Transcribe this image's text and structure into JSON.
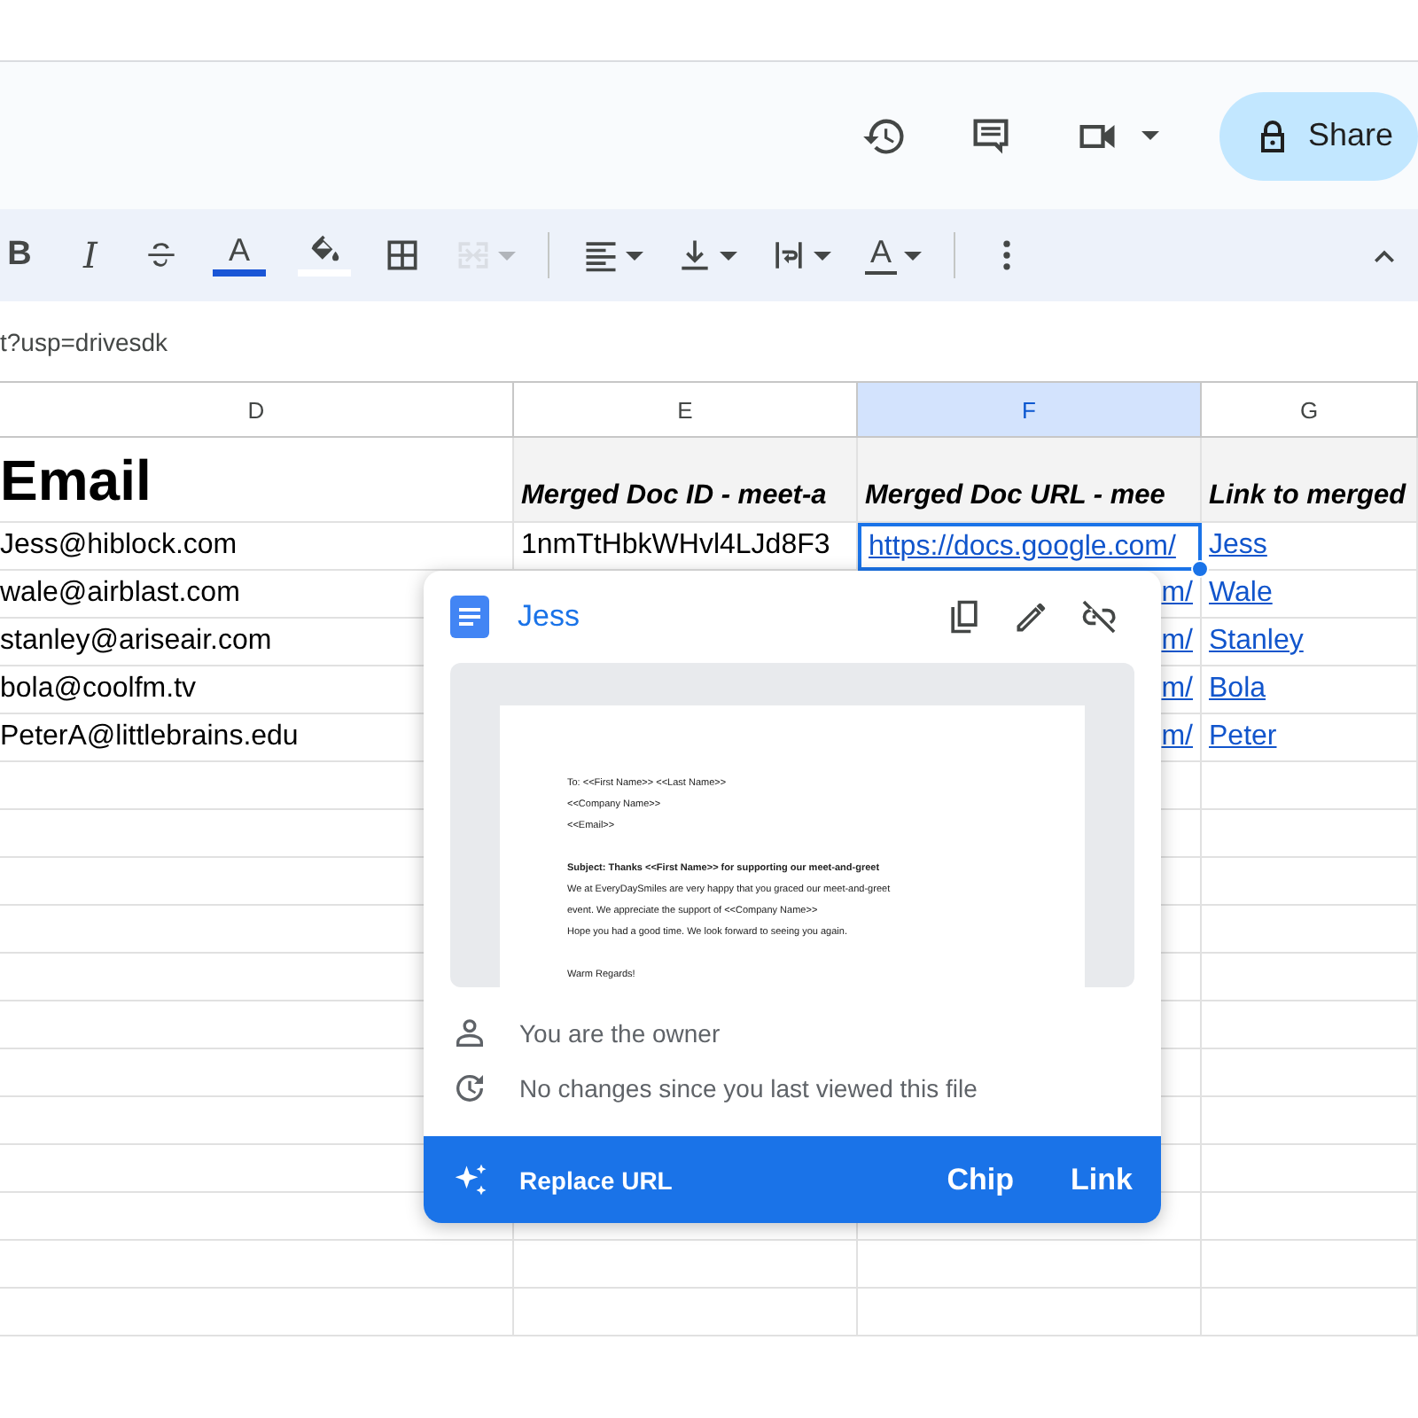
{
  "header_actions": [
    {
      "kind": "history"
    },
    {
      "kind": "comments"
    },
    {
      "kind": "meet"
    }
  ],
  "share_button": {
    "label": "Share"
  },
  "toolbar": [
    {
      "kind": "bold",
      "label": "B",
      "disabled": false
    },
    {
      "kind": "italic",
      "label": "I",
      "disabled": false
    },
    {
      "kind": "strikethrough",
      "disabled": false
    },
    {
      "kind": "text_color",
      "label": "A",
      "color": "#1a56d6",
      "disabled": false
    },
    {
      "kind": "fill_color",
      "color": "#ffffff",
      "disabled": false
    },
    {
      "kind": "borders",
      "disabled": false
    },
    {
      "kind": "merge",
      "disabled": true
    },
    {
      "kind": "separator"
    },
    {
      "kind": "align",
      "disabled": false
    },
    {
      "kind": "valign",
      "disabled": false
    },
    {
      "kind": "wrap",
      "disabled": false
    },
    {
      "kind": "rotate",
      "label": "A",
      "disabled": false
    },
    {
      "kind": "separator"
    },
    {
      "kind": "more",
      "disabled": false
    },
    {
      "kind": "collapse",
      "disabled": false
    }
  ],
  "formula_bar": {
    "value": "t?usp=drivesdk"
  },
  "columns": [
    {
      "label": "D",
      "selected": false
    },
    {
      "label": "E",
      "selected": false
    },
    {
      "label": "F",
      "selected": true
    },
    {
      "label": "G",
      "selected": false
    }
  ],
  "header_row": [
    "Email",
    "Merged Doc ID - meet-a",
    "Merged Doc URL - mee",
    "Link to merged"
  ],
  "rows": [
    {
      "cells": [
        {
          "kind": "text",
          "text": "Jess@hiblock.com",
          "selected": false
        },
        {
          "kind": "text",
          "text": "1nmTtHbkWHvl4LJd8F3",
          "selected": false
        },
        {
          "kind": "link",
          "text": "https://docs.google.com/",
          "selected": true
        },
        {
          "kind": "link",
          "text": "Jess",
          "selected": false
        }
      ]
    },
    {
      "cells": [
        {
          "kind": "text",
          "text": "wale@airblast.com",
          "selected": false
        },
        {
          "kind": "link_end",
          "text": "m/",
          "selected": false
        },
        {
          "kind": "link",
          "text": "Wale",
          "selected": false
        }
      ]
    },
    {
      "cells": [
        {
          "kind": "text",
          "text": "stanley@ariseair.com",
          "selected": false
        },
        {
          "kind": "link_end",
          "text": "m/",
          "selected": false
        },
        {
          "kind": "link",
          "text": "Stanley",
          "selected": false
        }
      ]
    },
    {
      "cells": [
        {
          "kind": "text",
          "text": "bola@coolfm.tv",
          "selected": false
        },
        {
          "kind": "link_end",
          "text": "m/",
          "selected": false
        },
        {
          "kind": "link",
          "text": "Bola",
          "selected": false
        }
      ]
    },
    {
      "cells": [
        {
          "kind": "text",
          "text": "PeterA@littlebrains.edu",
          "selected": false
        },
        {
          "kind": "link_end",
          "text": "m/",
          "selected": false
        },
        {
          "kind": "link",
          "text": "Peter",
          "selected": false
        }
      ]
    }
  ],
  "link_popup": {
    "title": "Jess",
    "actions": [
      {
        "kind": "copy"
      },
      {
        "kind": "edit"
      },
      {
        "kind": "unlink"
      }
    ],
    "preview_lines": [
      {
        "text": "To: <<First Name>> <<Last Name>>",
        "bold": false,
        "spaced": false
      },
      {
        "text": "<<Company Name>>",
        "bold": false,
        "spaced": false
      },
      {
        "text": "<<Email>>",
        "bold": false,
        "spaced": false
      },
      {
        "text": "Subject: Thanks <<First Name>> for supporting our meet-and-greet",
        "bold": true,
        "spaced": true
      },
      {
        "text": "We at EveryDaySmiles are very happy that you graced our meet-and-greet",
        "bold": false,
        "spaced": false
      },
      {
        "text": "event. We appreciate the support of <<Company Name>>",
        "bold": false,
        "spaced": false
      },
      {
        "text": "Hope you had a good time. We look forward to seeing you again.",
        "bold": false,
        "spaced": false
      },
      {
        "text": "Warm Regards!",
        "bold": false,
        "spaced": true
      }
    ],
    "info": [
      {
        "kind": "owner",
        "text": "You are the owner"
      },
      {
        "kind": "history",
        "text": "No changes since you last viewed this file"
      }
    ],
    "footer": {
      "replace_label": "Replace URL",
      "buttons": [
        "Chip",
        "Link"
      ]
    }
  }
}
